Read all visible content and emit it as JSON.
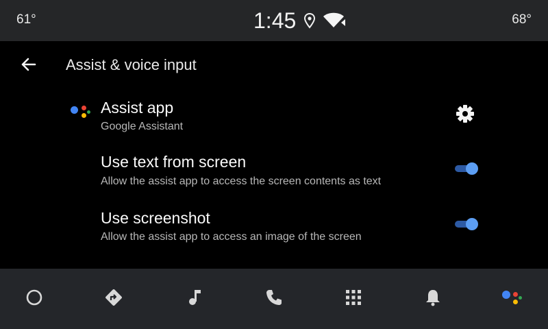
{
  "status_bar": {
    "temp_left": "61°",
    "time": "1:45",
    "temp_right": "68°",
    "icons": [
      "location-icon",
      "wifi-icon"
    ]
  },
  "header": {
    "back_icon": "arrow-left-icon",
    "title": "Assist & voice input"
  },
  "settings": [
    {
      "title": "Assist app",
      "subtitle": "Google Assistant",
      "control": "gear-icon"
    },
    {
      "title": "Use text from screen",
      "subtitle": "Allow the assist app to access the screen contents as text",
      "control": "toggle",
      "enabled": true
    },
    {
      "title": "Use screenshot",
      "subtitle": "Allow the assist app to access an image of the screen",
      "control": "toggle",
      "enabled": true
    }
  ],
  "nav_bar": {
    "items": [
      "home-icon",
      "navigation-icon",
      "music-icon",
      "phone-icon",
      "apps-grid-icon",
      "notifications-icon",
      "google-assistant-icon"
    ]
  },
  "colors": {
    "background": "#000000",
    "bars": "#252628",
    "toggle_thumb": "#5c9ef3",
    "toggle_track": "#2d5aa4",
    "assistant_blue": "#4285f4",
    "assistant_red": "#ea4335",
    "assistant_yellow": "#fbbc05",
    "assistant_green": "#34a853"
  }
}
